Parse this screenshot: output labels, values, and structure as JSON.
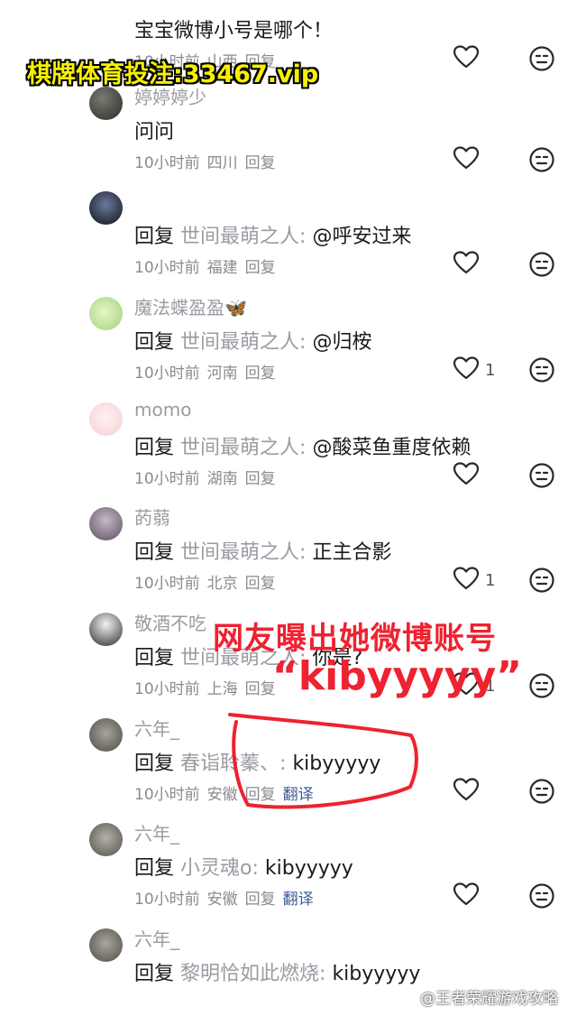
{
  "promo_text": "棋牌体育投注:33467.vip",
  "overlay": {
    "title": "网友曝出她微博账号",
    "account": "“kibyyyyy”"
  },
  "watermark": "@王者荣耀游戏攻略",
  "reply_label": "回复",
  "comments": [
    {
      "username": "",
      "reply_to": "",
      "text": "宝宝微博小号是哪个！",
      "time": "10小时前",
      "location": "山西",
      "reply": "回复",
      "translate": "",
      "likes": ""
    },
    {
      "username": "婷婷婷少",
      "reply_to": "",
      "text": "问问",
      "time": "10小时前",
      "location": "四川",
      "reply": "回复",
      "translate": "",
      "likes": ""
    },
    {
      "username": "",
      "reply_to": "世间最萌之人:",
      "text": "@呼安过来",
      "time": "10小时前",
      "location": "福建",
      "reply": "回复",
      "translate": "",
      "likes": ""
    },
    {
      "username": "魔法蝶盈盈🦋",
      "reply_to": "世间最萌之人:",
      "text": "@归桉",
      "time": "10小时前",
      "location": "河南",
      "reply": "回复",
      "translate": "",
      "likes": "1"
    },
    {
      "username": "momo",
      "reply_to": "世间最萌之人:",
      "text": "@酸菜鱼重度依赖",
      "time": "10小时前",
      "location": "湖南",
      "reply": "回复",
      "translate": "",
      "likes": ""
    },
    {
      "username": "菂蒻",
      "reply_to": "世间最萌之人:",
      "text": "正主合影",
      "time": "10小时前",
      "location": "北京",
      "reply": "回复",
      "translate": "",
      "likes": "1"
    },
    {
      "username": "敬酒不吃",
      "reply_to": "世间最萌之人:",
      "text": "你是?",
      "time": "10小时前",
      "location": "上海",
      "reply": "回复",
      "translate": "",
      "likes": "1"
    },
    {
      "username": "六年_",
      "reply_to": "春诣聆蓁、:",
      "text": "kibyyyyy",
      "time": "10小时前",
      "location": "安徽",
      "reply": "回复",
      "translate": "翻译",
      "likes": ""
    },
    {
      "username": "六年_",
      "reply_to": "小灵魂o:",
      "text": "kibyyyyy",
      "time": "10小时前",
      "location": "安徽",
      "reply": "回复",
      "translate": "翻译",
      "likes": ""
    },
    {
      "username": "六年_",
      "reply_to": "黎明恰如此燃烧:",
      "text": "kibyyyyy",
      "time": "",
      "location": "",
      "reply": "",
      "translate": "",
      "likes": ""
    }
  ]
}
